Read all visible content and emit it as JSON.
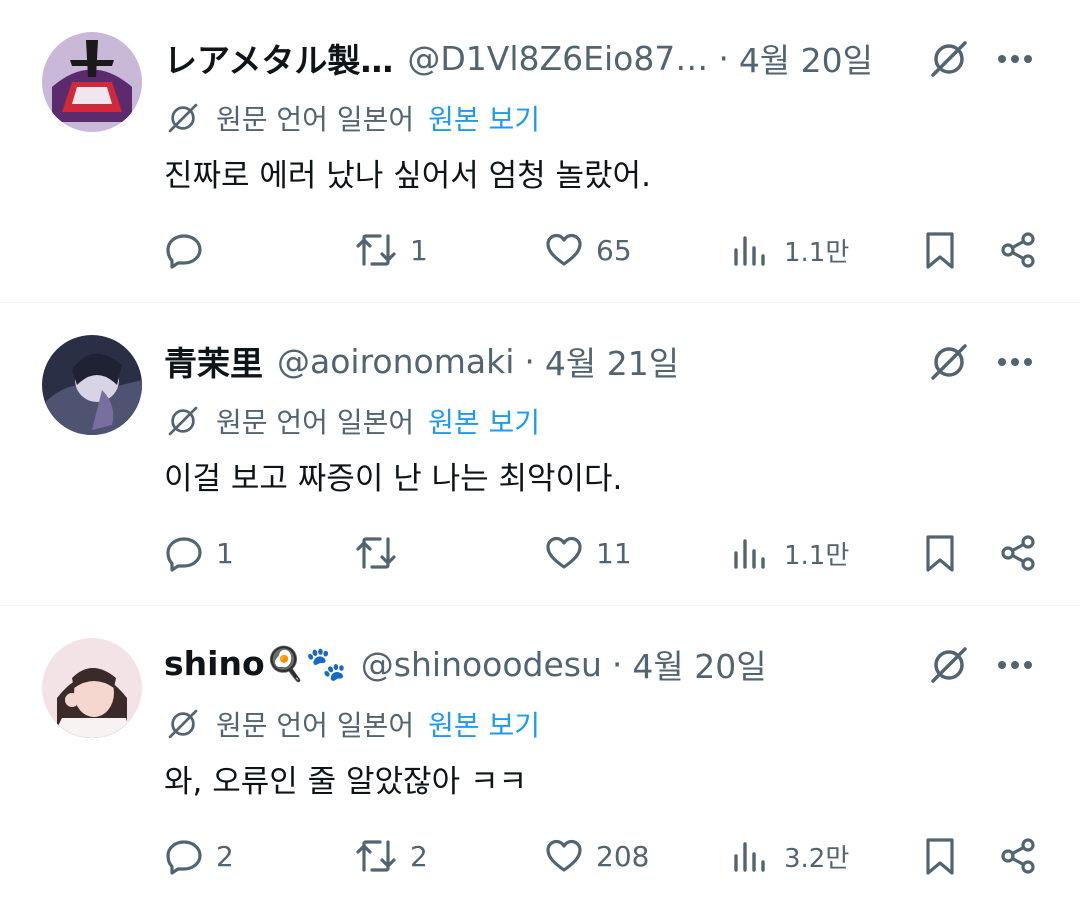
{
  "posts": [
    {
      "name": "レアメタル製…",
      "handle": "@D1Vl8Z6Eio87…",
      "separator": "·",
      "date": "4월 20일",
      "translate_label": "원문 언어 일본어",
      "translate_link": "원본 보기",
      "text": "진짜로 에러 났나 싶어서 엄청 놀랐어.",
      "replies": "",
      "reposts": "1",
      "likes": "65",
      "views": "1.1만"
    },
    {
      "name": "青茉里",
      "handle": "@aoironomaki",
      "separator": "·",
      "date": "4월 21일",
      "translate_label": "원문 언어 일본어",
      "translate_link": "원본 보기",
      "text": "이걸 보고 짜증이 난 나는 최악이다.",
      "replies": "1",
      "reposts": "",
      "likes": "11",
      "views": "1.1만"
    },
    {
      "name": "shino🍳🐾",
      "handle": "@shinooodesu",
      "separator": "·",
      "date": "4월 20일",
      "translate_label": "원문 언어 일본어",
      "translate_link": "원본 보기",
      "text": "와, 오류인 줄 알았잖아 ㅋㅋ",
      "replies": "2",
      "reposts": "2",
      "likes": "208",
      "views": "3.2만"
    }
  ],
  "colors": {
    "secondary_text": "#536471",
    "link": "#1d9bf0",
    "primary_text": "#0f1419",
    "divider": "#eff3f4"
  },
  "icons": [
    "grok-icon",
    "more-icon",
    "translate-icon",
    "reply-icon",
    "repost-icon",
    "like-icon",
    "views-icon",
    "bookmark-icon",
    "share-icon"
  ]
}
